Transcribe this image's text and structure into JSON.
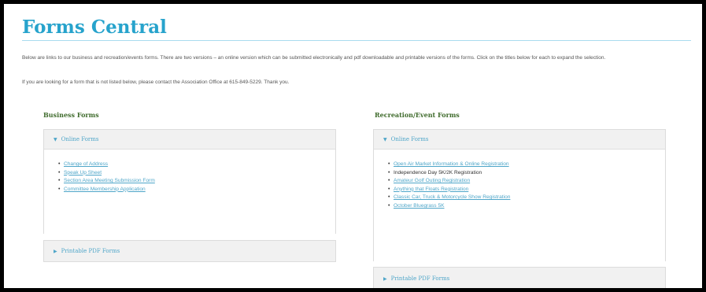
{
  "page": {
    "title": "Forms Central",
    "intro": "Below are links to our business and recreation/events forms. There are two versions – an online version which can be submitted electronically and pdf downloadable and printable versions of the forms. Click on the titles below for each to expand the selection.",
    "contact": "If you are looking for a form that is not listed below, please contact the Association Office at 615-849-5229. Thank you."
  },
  "business": {
    "heading": "Business Forms",
    "online_label": "Online Forms",
    "online_items": [
      "Change of Address",
      "Speak Up Sheet",
      "Section Area Meeting Submission Form",
      "Committee Membership Application"
    ],
    "pdf_label": "Printable PDF Forms"
  },
  "recreation": {
    "heading": "Recreation/Event Forms",
    "online_label": "Online Forms",
    "online_items": [
      "Open Air Market Information & Online Registration",
      "Independence Day 5K/2K Registration",
      "Amateur Golf Outing Registration",
      "Anything that Floats Registration",
      "Classic Car, Truck & Motorcycle Show Registration",
      "October Bluegrass 5K"
    ],
    "pdf_label": "Printable PDF Forms"
  },
  "icons": {
    "expanded": "triangle-down-icon",
    "collapsed": "triangle-right-icon"
  },
  "colors": {
    "title": "#27a3cc",
    "link": "#4fa6c9",
    "heading": "#3f6b2c"
  }
}
